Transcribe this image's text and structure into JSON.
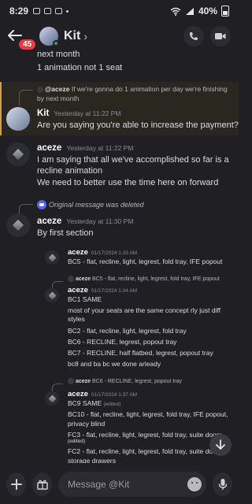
{
  "status": {
    "time": "8:29",
    "battery": "40%"
  },
  "header": {
    "back_icon": "arrow-left-icon",
    "badge": "45",
    "name": "Kit",
    "chevron": "›"
  },
  "messages": {
    "top_line1": "next month",
    "top_line2": "1 animation not 1 seat",
    "reply1": {
      "author": "@aceze",
      "text": "If we're gonna do 1 animation per day we're finishing",
      "cont": "by next month"
    },
    "kit": {
      "name": "Kit",
      "time": "Yesterday at 11:22 PM",
      "text": "Are you saying you're able to increase the payment?"
    },
    "aceze1": {
      "name": "aceze",
      "time": "Yesterday at 11:22 PM",
      "l1": "I am saying that all we've accomplished so far is a",
      "l2": "recline animation",
      "l3": "We need to better use the time here on forward"
    },
    "deleted": "Original message was deleted",
    "aceze2": {
      "name": "aceze",
      "time": "Yesterday at 11:30 PM",
      "text": "By first section"
    },
    "t1": {
      "name": "aceze",
      "time": "01/17/2024 1:33 AM",
      "text": "BC5 - flat, recline, light, legrest, fold tray, IFE popout"
    },
    "r2": {
      "author": "aceze",
      "text": "BC5 - flat, recline, light, legrest, fold tray, IFE popout"
    },
    "t2": {
      "name": "aceze",
      "time": "01/17/2024 1:34 AM",
      "l1": "BC1 SAME",
      "l2": "most of your seats are the same concept rly just diff",
      "l3": "styles",
      "l4": "BC2 - flat, recline, light, legrest, fold tray",
      "l5": "BC6 - RECLINE, legrest, popout tray",
      "l6": "BC7 - RECLINE, half flatbed, legrest, popout tray",
      "l7": "bc8 and ba bc we done arleady"
    },
    "r3": {
      "author": "aceze",
      "text": "BC6 - RECLINE, legrest, popout tray"
    },
    "t3": {
      "name": "aceze",
      "time": "01/17/2024 1:37 AM",
      "l1": "BC9 SAME",
      "edited": "(edited)",
      "l2": "BC10 - flat, recline, light, legrest, fold tray, IFE popout,",
      "l3": "privacy blind",
      "l4": "FC3 - flat, recline, light, legrest, fold tray, suite doors",
      "l5": "FC2 - flat, recline, light, legrest, fold tray, suite doors,",
      "l6": "storage drawers"
    }
  },
  "composer": {
    "placeholder": "Message @Kit"
  },
  "icons": {
    "add": "plus-icon",
    "gift": "gift-icon",
    "emoji": "emoji-icon",
    "mic": "mic-icon",
    "call": "phone-icon",
    "video": "video-icon",
    "scroll": "arrow-down-icon"
  },
  "colors": {
    "background": "#1f1f24",
    "mention_highlight": "#c9a443",
    "badge": "#e53b45",
    "online": "#3ba55d"
  }
}
